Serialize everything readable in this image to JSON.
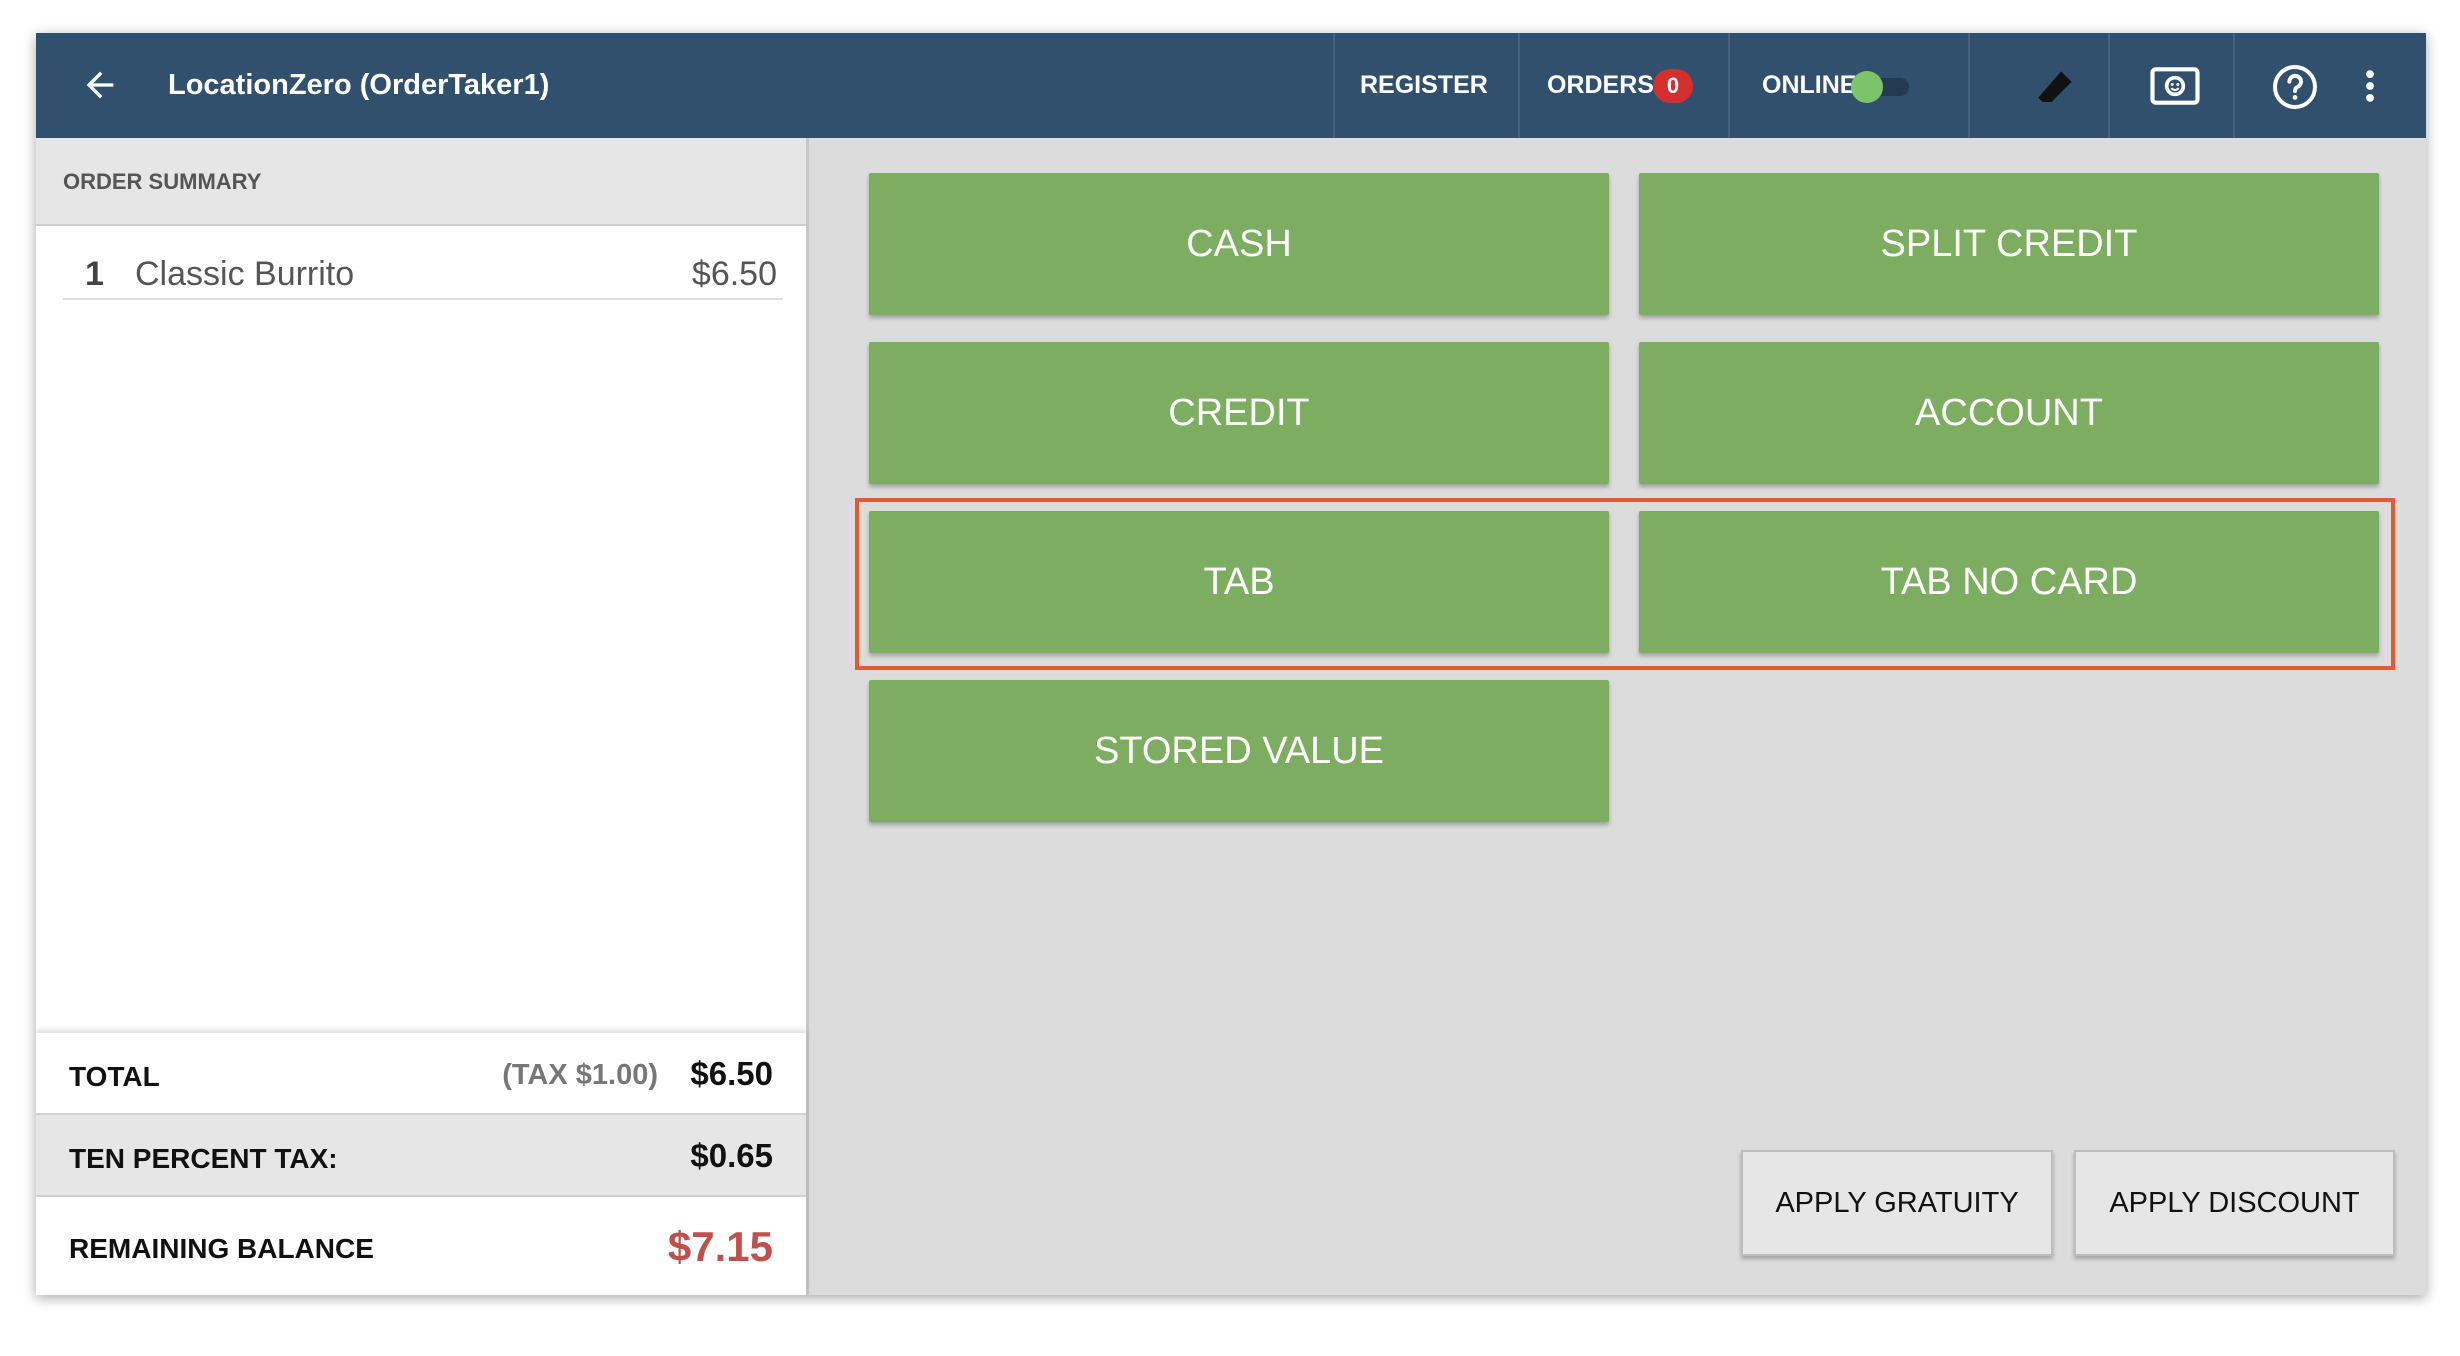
{
  "header": {
    "title": "LocationZero (OrderTaker1)",
    "register_label": "REGISTER",
    "orders_label": "ORDERS",
    "orders_count": "0",
    "online_label": "ONLINE",
    "online_state": "on",
    "bar_color": "#30506e"
  },
  "order_summary": {
    "heading": "ORDER SUMMARY",
    "items": [
      {
        "qty": "1",
        "name": "Classic Burrito",
        "price": "$6.50"
      }
    ]
  },
  "totals": {
    "total_label": "TOTAL",
    "tax_note": "(TAX $1.00)",
    "total_value": "$6.50",
    "tax_label": "TEN PERCENT TAX:",
    "tax_value": "$0.65",
    "balance_label": "REMAINING BALANCE",
    "balance_value": "$7.15",
    "balance_color": "#c0504d"
  },
  "payment_buttons": {
    "cash": "CASH",
    "split_credit": "SPLIT CREDIT",
    "credit": "CREDIT",
    "account": "ACCOUNT",
    "tab": "TAB",
    "tab_no_card": "TAB NO CARD",
    "stored_value": "STORED VALUE",
    "button_color": "#7dad60"
  },
  "actions": {
    "apply_gratuity": "APPLY GRATUITY",
    "apply_discount": "APPLY DISCOUNT"
  },
  "icons": {
    "back": "arrow-left-icon",
    "eraser": "eraser-icon",
    "cash_drawer": "cash-drawer-icon",
    "help": "help-circle-icon",
    "more": "more-vertical-icon"
  },
  "highlight_color": "#e05a33"
}
